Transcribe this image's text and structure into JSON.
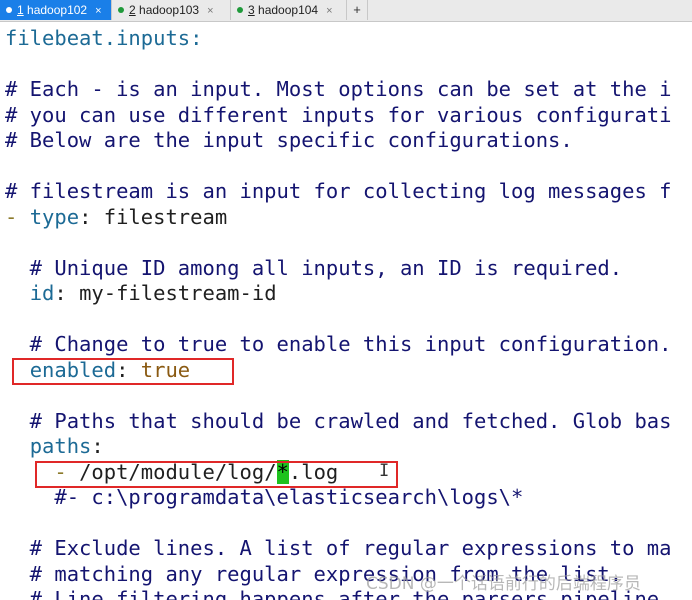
{
  "tabs": [
    {
      "num": "1",
      "name": " hadoop102",
      "active": true
    },
    {
      "num": "2",
      "name": " hadoop103",
      "active": false
    },
    {
      "num": "3",
      "name": " hadoop104",
      "active": false
    }
  ],
  "tab_close_glyph": "×",
  "new_tab_glyph": "+",
  "editor": {
    "l01": "filebeat.inputs:",
    "l03": "# Each - is an input. Most options can be set at the i",
    "l04": "# you can use different inputs for various configurati",
    "l05": "# Below are the input specific configurations.",
    "l07": "# filestream is an input for collecting log messages f",
    "l08_dash": "- ",
    "l08_key": "type",
    "l08_colon": ": ",
    "l08_val": "filestream",
    "l10": "  # Unique ID among all inputs, an ID is required.",
    "l11_indent": "  ",
    "l11_key": "id",
    "l11_colon": ": ",
    "l11_val": "my-filestream-id",
    "l13": "  # Change to true to enable this input configuration.",
    "l14_indent": "  ",
    "l14_key": "enabled",
    "l14_colon": ": ",
    "l14_val": "true",
    "l16": "  # Paths that should be crawled and fetched. Glob bas",
    "l17_indent": "  ",
    "l17_key": "paths",
    "l17_colon": ":",
    "l18_dash": "    - ",
    "l18_pre": "/opt/module/log/",
    "l18_cursor": "*",
    "l18_post": ".log",
    "l19": "    #- c:\\programdata\\elasticsearch\\logs\\*",
    "l21": "  # Exclude lines. A list of regular expressions to ma",
    "l22": "  # matching any regular expression from the list.",
    "l23": "  # Line filtering happens after the parsers pipeline."
  },
  "watermark": "CSDN @一个话语前行的后端程序员",
  "ibeam_glyph": "I"
}
